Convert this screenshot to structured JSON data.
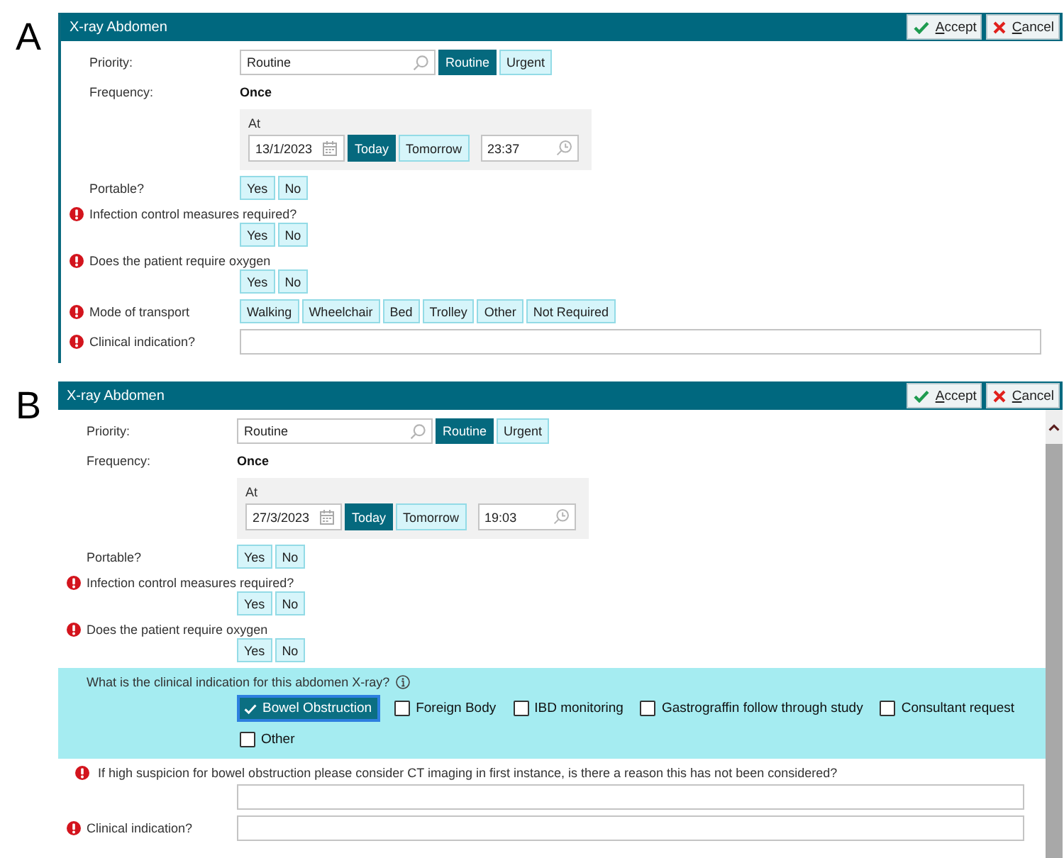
{
  "panels": [
    {
      "label": "A",
      "title": "X-ray Abdomen",
      "bordered": true,
      "scrollbar": false,
      "actions": [
        {
          "kind": "accept",
          "label": "Accept"
        },
        {
          "kind": "cancel",
          "label": "Cancel"
        }
      ],
      "rows": [
        {
          "kind": "lookup",
          "label": "Priority:",
          "required": false,
          "value": "Routine",
          "options": [
            {
              "label": "Routine",
              "selected": true
            },
            {
              "label": "Urgent",
              "selected": false
            }
          ]
        },
        {
          "kind": "static",
          "label": "Frequency:",
          "required": false,
          "value": "Once"
        },
        {
          "kind": "datetime",
          "label": "At",
          "required": false,
          "date": "13/1/2023",
          "options": [
            {
              "label": "Today",
              "selected": true
            },
            {
              "label": "Tomorrow",
              "selected": false
            }
          ],
          "time": "23:37"
        },
        {
          "kind": "choice",
          "label": "Portable?",
          "required": false,
          "options": [
            {
              "label": "Yes",
              "selected": false
            },
            {
              "label": "No",
              "selected": false
            }
          ]
        },
        {
          "kind": "choice",
          "label": "Infection control measures required?",
          "required": true,
          "options": [
            {
              "label": "Yes",
              "selected": false
            },
            {
              "label": "No",
              "selected": false
            }
          ]
        },
        {
          "kind": "choice",
          "label": "Does the patient require oxygen",
          "required": true,
          "options": [
            {
              "label": "Yes",
              "selected": false
            },
            {
              "label": "No",
              "selected": false
            }
          ]
        },
        {
          "kind": "choice",
          "label": "Mode of transport",
          "required": true,
          "options": [
            {
              "label": "Walking",
              "selected": false
            },
            {
              "label": "Wheelchair",
              "selected": false
            },
            {
              "label": "Bed",
              "selected": false
            },
            {
              "label": "Trolley",
              "selected": false
            },
            {
              "label": "Other",
              "selected": false
            },
            {
              "label": "Not Required",
              "selected": false
            }
          ]
        },
        {
          "kind": "text",
          "label": "Clinical indication?",
          "required": true
        }
      ]
    },
    {
      "label": "B",
      "title": "X-ray Abdomen",
      "bordered": false,
      "scrollbar": true,
      "actions": [
        {
          "kind": "accept",
          "label": "Accept"
        },
        {
          "kind": "cancel",
          "label": "Cancel"
        }
      ],
      "rows": [
        {
          "kind": "lookup",
          "label": "Priority:",
          "required": false,
          "value": "Routine",
          "options": [
            {
              "label": "Routine",
              "selected": true
            },
            {
              "label": "Urgent",
              "selected": false
            }
          ]
        },
        {
          "kind": "static",
          "label": "Frequency:",
          "required": false,
          "value": "Once"
        },
        {
          "kind": "datetime",
          "label": "At",
          "required": false,
          "date": "27/3/2023",
          "options": [
            {
              "label": "Today",
              "selected": true
            },
            {
              "label": "Tomorrow",
              "selected": false
            }
          ],
          "time": "19:03"
        },
        {
          "kind": "choice",
          "label": "Portable?",
          "required": false,
          "options": [
            {
              "label": "Yes",
              "selected": false
            },
            {
              "label": "No",
              "selected": false
            }
          ]
        },
        {
          "kind": "choice",
          "label": "Infection control measures required?",
          "required": true,
          "options": [
            {
              "label": "Yes",
              "selected": false
            },
            {
              "label": "No",
              "selected": false
            }
          ]
        },
        {
          "kind": "choice",
          "label": "Does the patient require oxygen",
          "required": true,
          "options": [
            {
              "label": "Yes",
              "selected": false
            },
            {
              "label": "No",
              "selected": false
            }
          ]
        },
        {
          "kind": "checklist",
          "label": "What is the clinical indication for this abdomen X-ray?",
          "required": false,
          "highlighted": true,
          "options": [
            {
              "label": "Bowel Obstruction",
              "checked": true
            },
            {
              "label": "Foreign Body",
              "checked": false
            },
            {
              "label": "IBD monitoring",
              "checked": false
            },
            {
              "label": "Gastrograffin follow through study",
              "checked": false
            },
            {
              "label": "Consultant request",
              "checked": false
            },
            {
              "label": "Other",
              "checked": false
            }
          ]
        },
        {
          "kind": "followup",
          "label": "If high suspicion for bowel obstruction please consider CT imaging in first instance, is there a reason this has not been considered?",
          "required": true
        },
        {
          "kind": "text",
          "label": "Clinical indication?",
          "required": true
        }
      ]
    }
  ]
}
